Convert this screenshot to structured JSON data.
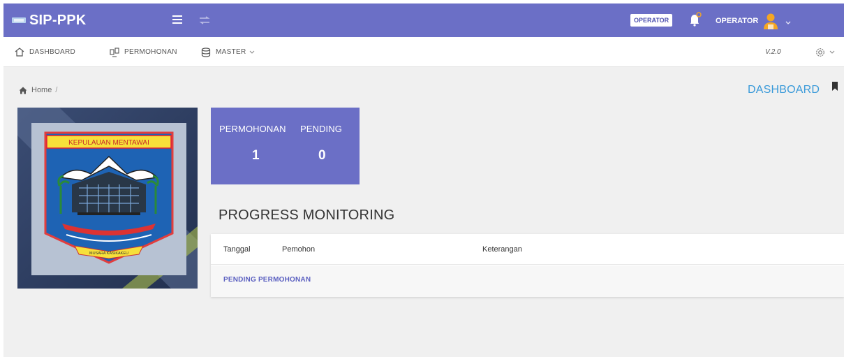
{
  "app": {
    "title": "SIP-PPK"
  },
  "topbar": {
    "role_badge": "OPERATOR",
    "user_name": "OPERATOR",
    "icons": [
      "hamburger-icon",
      "swap-icon",
      "bell-icon",
      "avatar",
      "chevron-down-icon"
    ]
  },
  "menu": {
    "items": [
      {
        "label": "DASHBOARD",
        "icon": "home-icon"
      },
      {
        "label": "PERMOHONAN",
        "icon": "transfer-icon"
      },
      {
        "label": "MASTER",
        "icon": "database-icon"
      }
    ],
    "version": "V.2.0",
    "settings_icon": "gear-icon"
  },
  "breadcrumb": {
    "home": "Home",
    "separator": "/"
  },
  "page": {
    "title": "DASHBOARD"
  },
  "banner": {
    "emblem_text": "KEPULAUAN MENTAWAI",
    "emblem_motto": "MUSARA KASIKAKEU"
  },
  "stats": [
    {
      "label": "PERMOHONAN",
      "value": "1"
    },
    {
      "label": "PENDING",
      "value": "0"
    }
  ],
  "monitoring": {
    "title": "PROGRESS MONITORING",
    "columns": [
      "Tanggal",
      "Pemohon",
      "Keterangan"
    ],
    "rows": [
      {
        "label": "PENDING PERMOHONAN"
      }
    ]
  },
  "colors": {
    "primary": "#6b6fc6",
    "accent": "#3a9ad9",
    "badge_text": "#4f53b0"
  }
}
